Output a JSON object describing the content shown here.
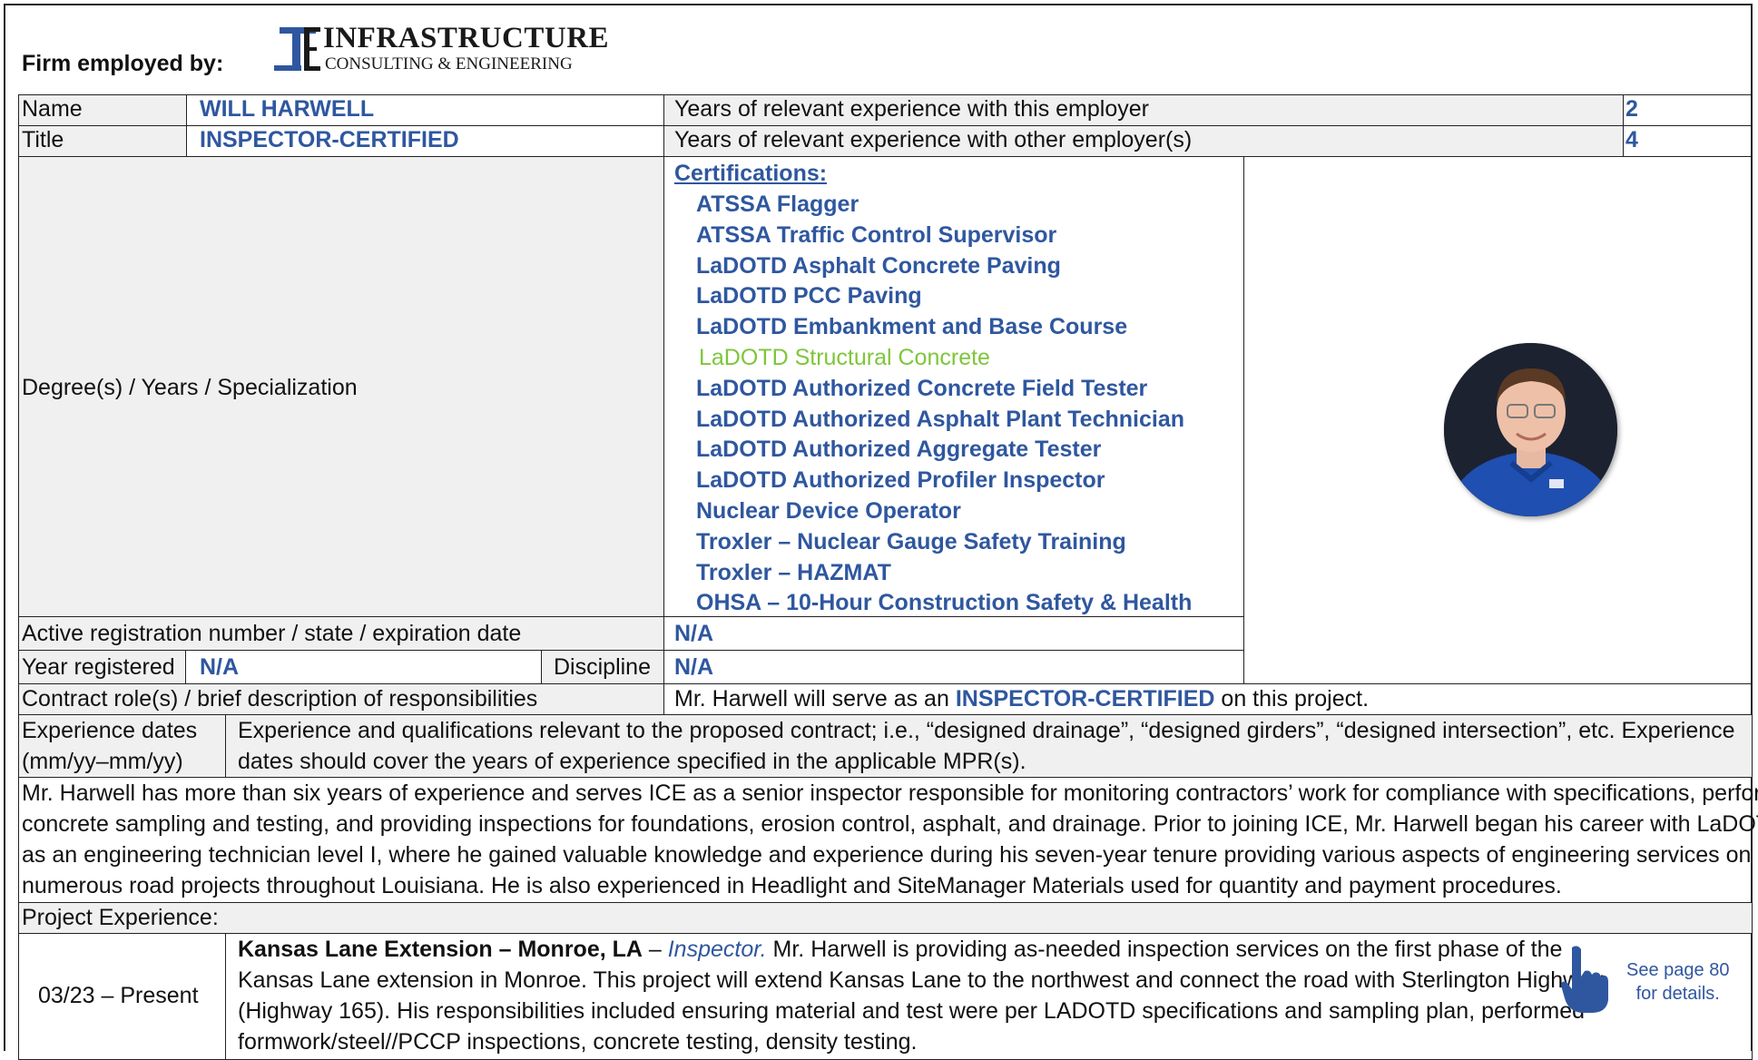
{
  "header": {
    "firm_label": "Firm employed by:",
    "logo_line1": "INFRASTRUCTURE",
    "logo_line2": "CONSULTING & ENGINEERING"
  },
  "info": {
    "name_label": "Name",
    "name_value": "WILL HARWELL",
    "title_label": "Title",
    "title_value": "INSPECTOR-CERTIFIED",
    "years_employer_label": "Years of relevant experience with this employer",
    "years_employer_value": "2",
    "years_other_label": "Years of relevant experience with other employer(s)",
    "years_other_value": "4",
    "degree_label": "Degree(s) / Years / Specialization",
    "registration_label": "Active registration number / state / expiration date",
    "registration_value": "N/A",
    "year_registered_label": "Year registered",
    "year_registered_value": "N/A",
    "discipline_label": "Discipline",
    "discipline_value": "N/A",
    "contract_role_label": "Contract role(s) / brief description of responsibilities",
    "contract_role_prefix": "Mr. Harwell will serve as an ",
    "contract_role_title": "INSPECTOR-CERTIFIED",
    "contract_role_suffix": " on this project."
  },
  "certifications": {
    "heading": "Certifications:",
    "items": [
      "ATSSA Flagger",
      "ATSSA Traffic Control Supervisor",
      "LaDOTD Asphalt Concrete Paving",
      "LaDOTD PCC Paving",
      "LaDOTD Embankment and Base Course",
      "LaDOTD Structural Concrete",
      "LaDOTD Authorized Concrete Field Tester",
      "LaDOTD Authorized Asphalt Plant Technician",
      "LaDOTD Authorized Aggregate Tester",
      "LaDOTD Authorized Profiler Inspector",
      "Nuclear Device Operator",
      "Troxler – Nuclear Gauge Safety Training",
      "Troxler – HAZMAT",
      "OHSA – 10-Hour Construction Safety & Health"
    ],
    "highlight_color": "#7ec63a",
    "text_color": "#2f579f"
  },
  "experience": {
    "dates_label_line1": "Experience dates",
    "dates_label_line2": "(mm/yy–mm/yy)",
    "desc_line1": "Experience and qualifications relevant to the proposed contract; i.e., “designed drainage”, “designed girders”, “designed intersection”, etc.  Experience",
    "desc_line2": "dates should cover the years of experience specified in the applicable MPR(s).",
    "summary_lines": [
      "Mr. Harwell has more than six years of experience and serves ICE as a senior inspector responsible for monitoring contractors’ work for compliance with specifications, performing",
      "concrete sampling and testing, and providing inspections for foundations, erosion control, asphalt, and drainage. Prior to joining ICE, Mr. Harwell began his career with LaDOTD",
      "as an engineering technician level I, where he gained valuable knowledge and experience during his seven-year tenure providing various aspects of engineering services on",
      "numerous road projects throughout Louisiana. He is also experienced in Headlight and SiteManager Materials used for quantity and payment procedures."
    ],
    "project_experience_label": "Project Experience:"
  },
  "project": {
    "dates": "03/23 – Present",
    "title": "Kansas Lane Extension – Monroe, LA",
    "dash": " – ",
    "role": "Inspector.",
    "line1_rest": " Mr. Harwell is providing as-needed inspection services on the first phase of the",
    "line2": "Kansas Lane extension in Monroe. This project will extend Kansas Lane to the northwest and connect the road with Sterlington Highway",
    "line3": "(Highway 165). His responsibilities included ensuring material and test were per LADOTD specifications and sampling plan, performed",
    "line4": "formwork/steel//PCCP inspections, concrete testing, density testing.",
    "see_line1": "See page  80",
    "see_line2": "for details.",
    "icon": "pointing-hand-icon"
  }
}
